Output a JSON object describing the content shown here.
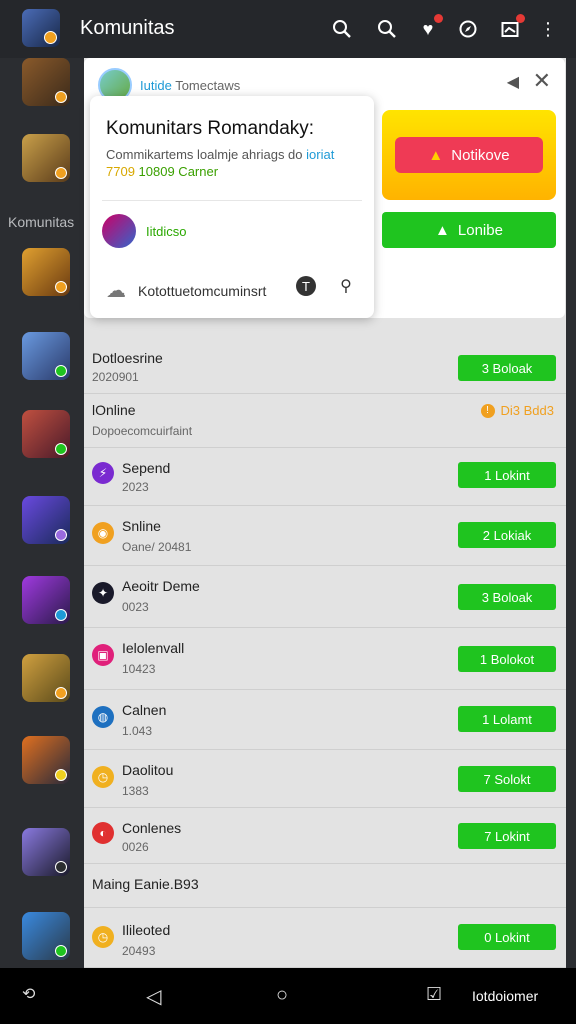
{
  "header": {
    "title": "Komunitas"
  },
  "sidebar": {
    "label": "Komunitas"
  },
  "panel": {
    "name_prefix": "Iutide",
    "name": "Tomectaws",
    "card": {
      "title": "Komunitars Romandaky:",
      "desc": "Commikartems loalmje ahriags do",
      "desc_link": "ioriat",
      "desc2_prefix": "7709",
      "desc2": "10809 Carner",
      "member": "Iitdicso",
      "footer": "Kotottuetomcuminsrt"
    },
    "notice_button": "Notikove",
    "green_button": "Lonibe"
  },
  "rows": [
    {
      "t1": "Dotloesrine",
      "t2": "2020901",
      "action": "3 Boloak"
    },
    {
      "t1": "lOnline",
      "t2": "Dopoecomcuirfaint",
      "orange": "Di3 Bdd3"
    },
    {
      "t1": "Sepend",
      "t2": "2023",
      "action": "1 Lokint"
    },
    {
      "t1": "Snline",
      "t2": "Oane/ 20481",
      "action": "2 Lokiak"
    },
    {
      "t1": "Aeoitr Deme",
      "t2": "0023",
      "action": "3 Boloak"
    },
    {
      "t1": "Ielolenvall",
      "t2": "10423",
      "action": "1 Bolokot"
    },
    {
      "t1": "Calnen",
      "t2": "1.043",
      "action": "1 Lolamt"
    },
    {
      "t1": "Daolitou",
      "t2": "1383",
      "action": "7 Solokt"
    },
    {
      "t1": "Conlenes",
      "t2": "0026",
      "action": "7 Lokint"
    },
    {
      "t1": "Maing Eanie.B93"
    },
    {
      "t1": "Ilileoted",
      "t2": "20493",
      "action": "0 Lokint"
    }
  ],
  "navbar": {
    "label": "Iotdoiomer"
  },
  "colors": {
    "green": "#1fc41f",
    "notice": "#ef3a55",
    "topbar": "#25272b"
  }
}
